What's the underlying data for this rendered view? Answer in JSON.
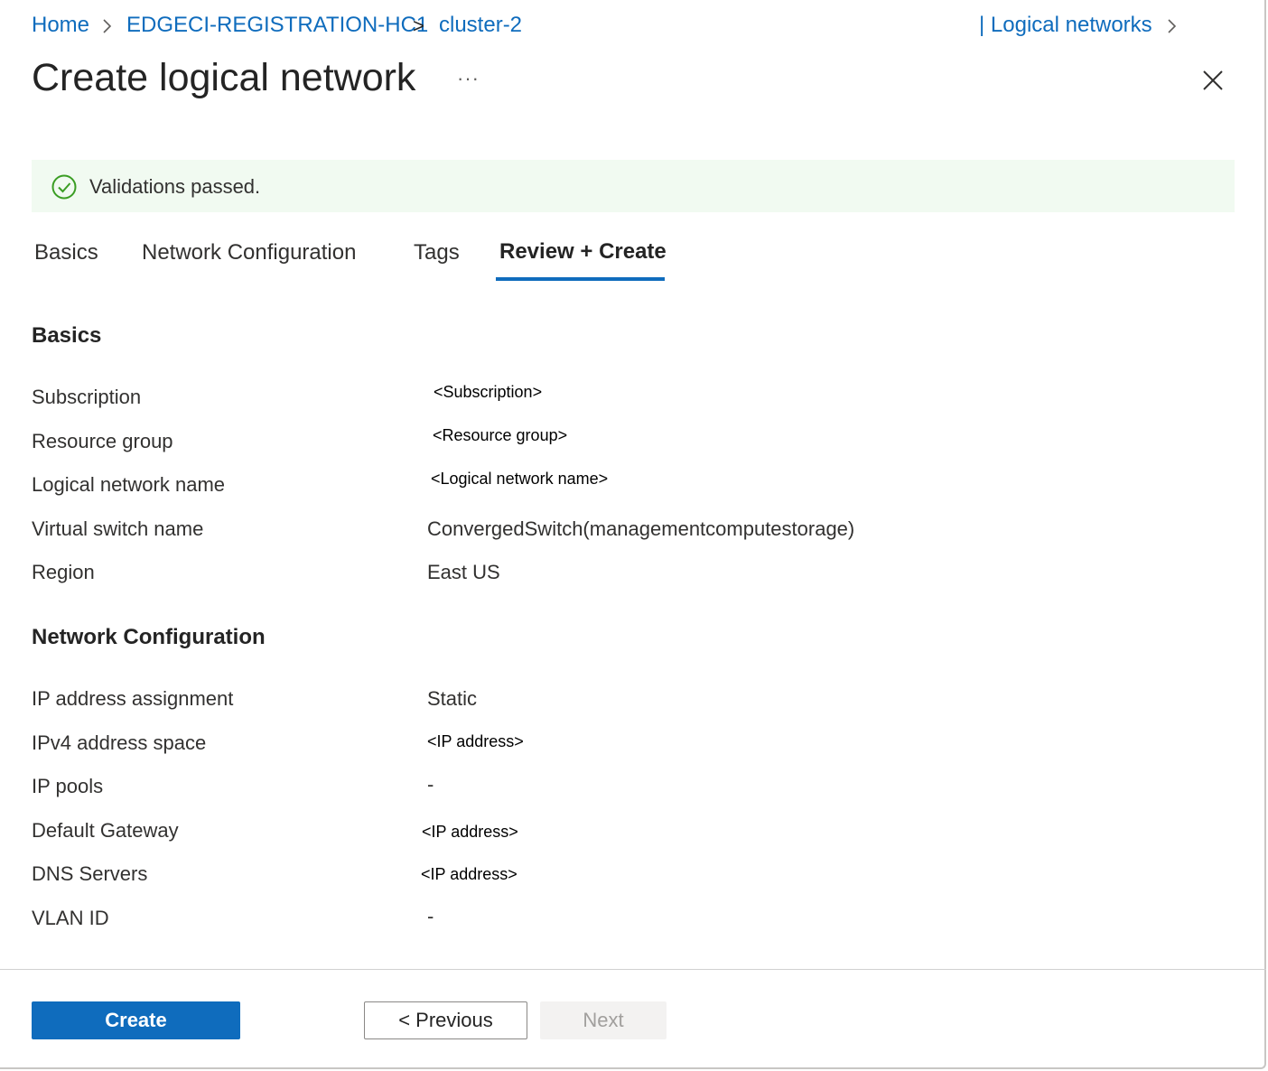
{
  "breadcrumb": {
    "items": [
      "Home",
      "EDGECI-REGISTRATION-HC1",
      "cluster-2"
    ],
    "separator_1": ">",
    "separator_2": ">",
    "right_link": "| Logical networks"
  },
  "page": {
    "title": "Create logical network",
    "more_label": "···"
  },
  "banner": {
    "text": "Validations passed.",
    "status_color": "#3a9d23"
  },
  "tabs": [
    {
      "label": "Basics",
      "active": false
    },
    {
      "label": "Network Configuration",
      "active": false
    },
    {
      "label": "Tags",
      "active": false
    },
    {
      "label": "Review + Create",
      "active": true
    }
  ],
  "sections": {
    "basics": {
      "heading": "Basics",
      "rows": [
        {
          "label": "Subscription",
          "value": "<Subscription>"
        },
        {
          "label": "Resource group",
          "value": "<Resource group>"
        },
        {
          "label": "Logical network name",
          "value": "<Logical network name>"
        },
        {
          "label": "Virtual switch name",
          "value": "ConvergedSwitch(managementcomputestorage)"
        },
        {
          "label": "Region",
          "value": "East US"
        }
      ]
    },
    "network": {
      "heading": "Network Configuration",
      "rows": [
        {
          "label": "IP address assignment",
          "value": "Static"
        },
        {
          "label": "IPv4 address space",
          "value": "<IP address>"
        },
        {
          "label": "IP pools",
          "value": "-"
        },
        {
          "label": "Default Gateway",
          "value": "<IP address>"
        },
        {
          "label": "DNS Servers",
          "value": "<IP address>"
        },
        {
          "label": "VLAN ID",
          "value": "-"
        }
      ]
    }
  },
  "footer": {
    "create_label": "Create",
    "previous_label": "< Previous",
    "next_label": "Next"
  },
  "colors": {
    "accent": "#0f6cbd",
    "banner_bg": "#f1faf1",
    "success": "#3a9d23"
  }
}
